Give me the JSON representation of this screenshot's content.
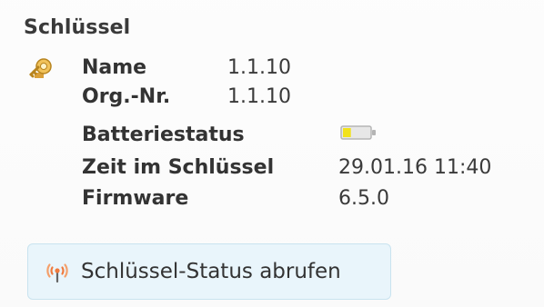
{
  "section": {
    "title": "Schlüssel",
    "icon": "key-icon"
  },
  "fields": {
    "name": {
      "label": "Name",
      "value": "1.1.10"
    },
    "org_nr": {
      "label": "Org.-Nr.",
      "value": "1.1.10"
    },
    "battery": {
      "label": "Batteriestatus",
      "level": 0.3,
      "icon": "battery-low-icon"
    },
    "time": {
      "label": "Zeit im Schlüssel",
      "value": "29.01.16 11:40"
    },
    "firmware": {
      "label": "Firmware",
      "value": "6.5.0"
    }
  },
  "action": {
    "label": "Schlüssel-Status abrufen",
    "icon": "signal-antenna-icon"
  },
  "colors": {
    "button_bg": "#e9f5fb",
    "button_border": "#c9e3ef",
    "battery_fill": "#f2e21b",
    "battery_shell": "#bdbdbd",
    "signal_accent": "#f07a3d",
    "key_gold": "#e3b24d"
  }
}
